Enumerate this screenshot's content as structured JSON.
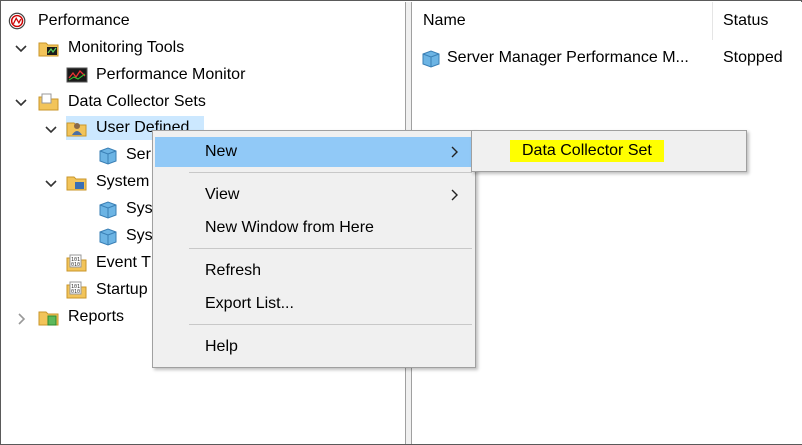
{
  "tree": {
    "root": "Performance",
    "monitoring_tools": "Monitoring Tools",
    "performance_monitor": "Performance Monitor",
    "data_collector_sets": "Data Collector Sets",
    "user_defined": "User Defined",
    "user_defined_child": "Ser",
    "system": "System",
    "system_child_1": "Sys",
    "system_child_2": "Sys",
    "event_trace": "Event T",
    "startup": "Startup",
    "reports": "Reports"
  },
  "list": {
    "columns": [
      "Name",
      "Status"
    ],
    "rows": [
      {
        "name": "Server Manager Performance M...",
        "status": "Stopped"
      }
    ]
  },
  "context_menu": {
    "items": [
      "New",
      "View",
      "New Window from Here",
      "Refresh",
      "Export List...",
      "Help"
    ],
    "submenu": {
      "items": [
        "Data Collector Set"
      ]
    }
  },
  "colors": {
    "menu_highlight": "#91c9f7",
    "tree_selected": "#cce8ff",
    "annotation_highlight": "#ffff00"
  }
}
